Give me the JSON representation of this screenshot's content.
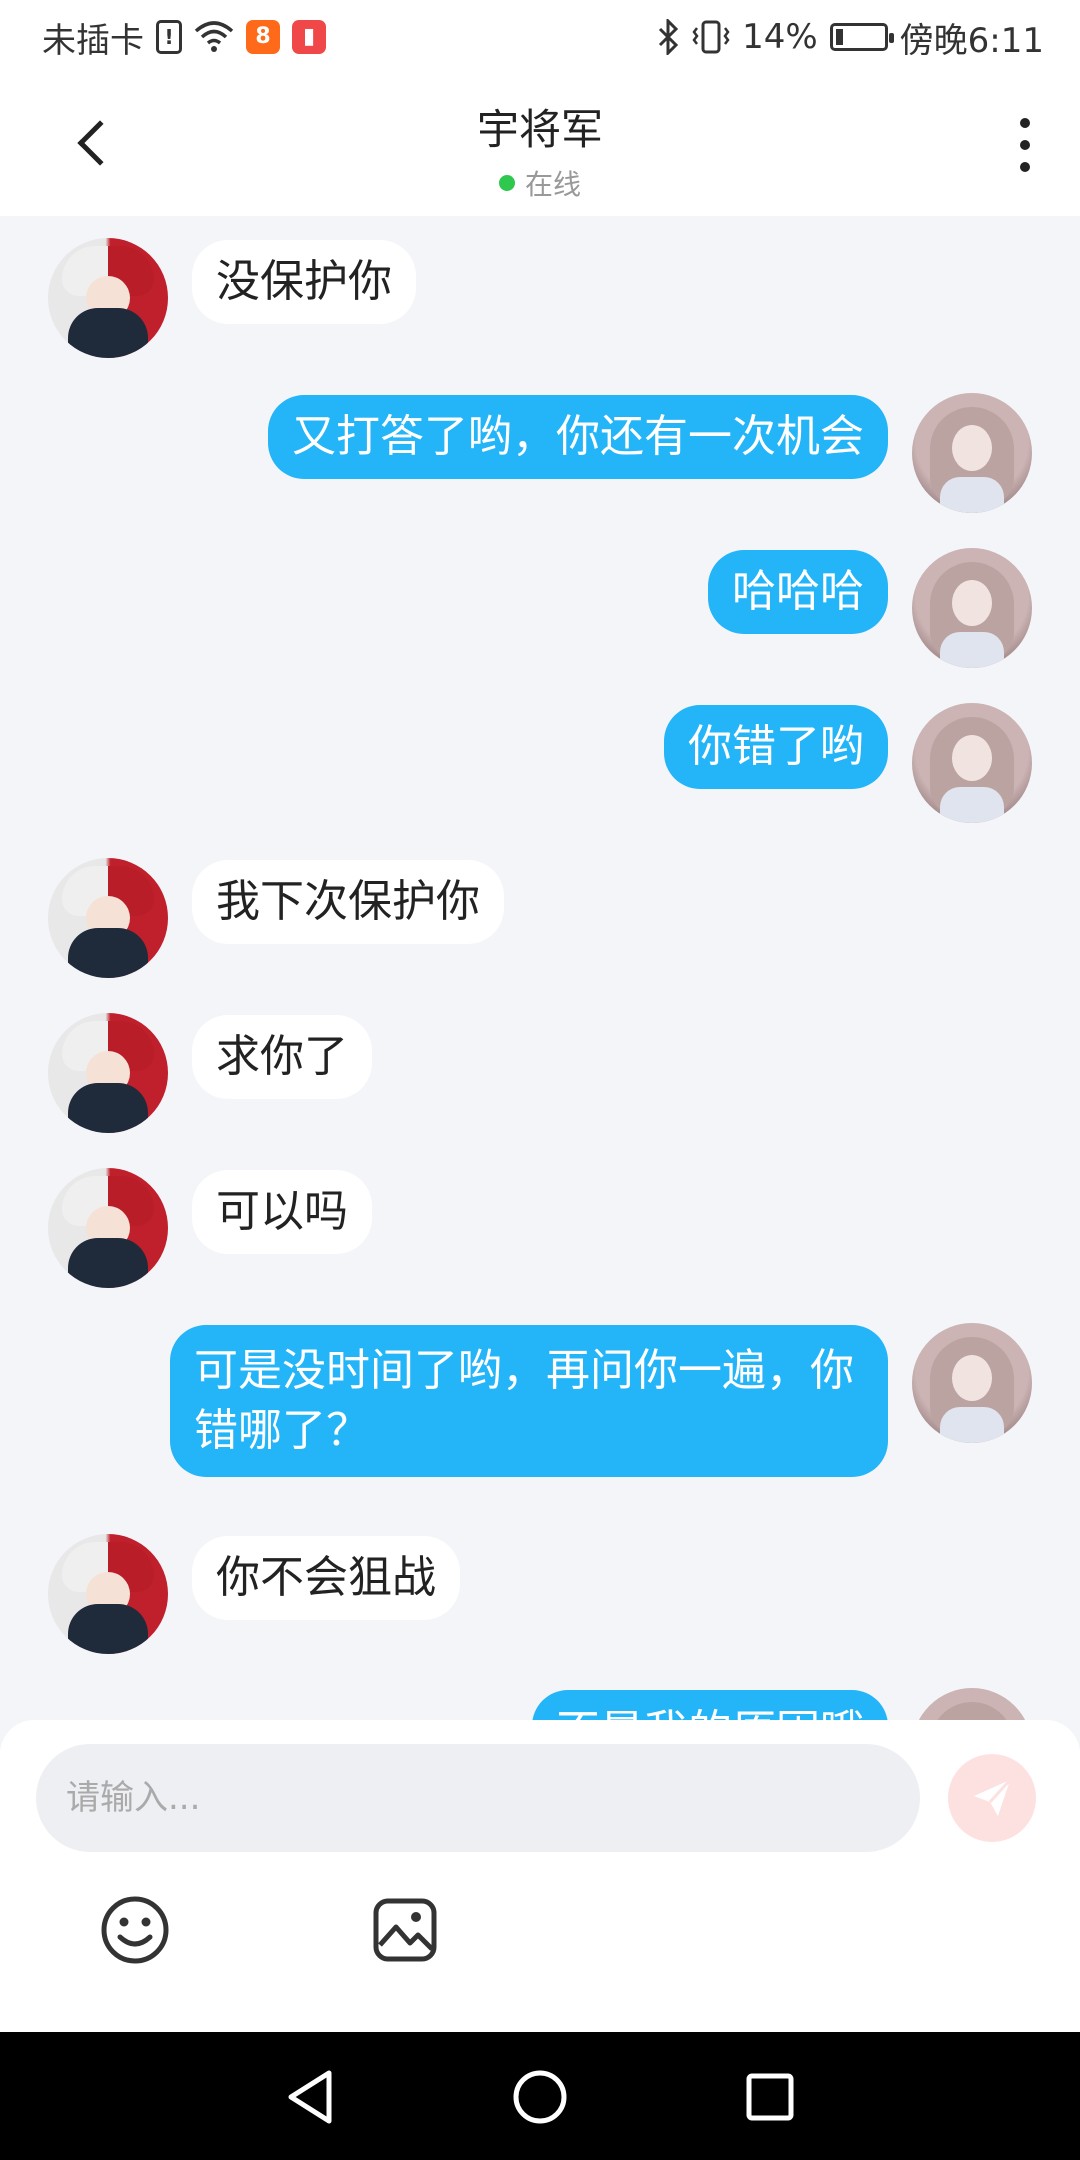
{
  "status_bar": {
    "carrier": "未插卡",
    "battery_percent": "14%",
    "time": "傍晚6:11",
    "battery_level": 0.14,
    "icons": [
      "sim-alert-icon",
      "wifi-icon",
      "app-icon",
      "app-icon",
      "bluetooth-icon",
      "vibrate-icon",
      "battery-icon"
    ]
  },
  "header": {
    "title": "宇将军",
    "status": "在线",
    "status_color": "#2fc84e"
  },
  "messages": [
    {
      "side": "left",
      "text": "没保护你"
    },
    {
      "side": "right",
      "text": "又打答了哟，你还有一次机会"
    },
    {
      "side": "right",
      "text": "哈哈哈"
    },
    {
      "side": "right",
      "text": "你错了哟"
    },
    {
      "side": "left",
      "text": "我下次保护你"
    },
    {
      "side": "left",
      "text": "求你了"
    },
    {
      "side": "left",
      "text": "可以吗"
    },
    {
      "side": "right",
      "text": "可是没时间了哟，再问你一遍，你错哪了？"
    },
    {
      "side": "left",
      "text": "你不会狙战"
    },
    {
      "side": "right",
      "text": "不是我的原因哦"
    }
  ],
  "input": {
    "placeholder": "请输入..."
  },
  "colors": {
    "accent": "#24b4f8",
    "send": "#fde1e1",
    "background": "#f4f5f9"
  }
}
